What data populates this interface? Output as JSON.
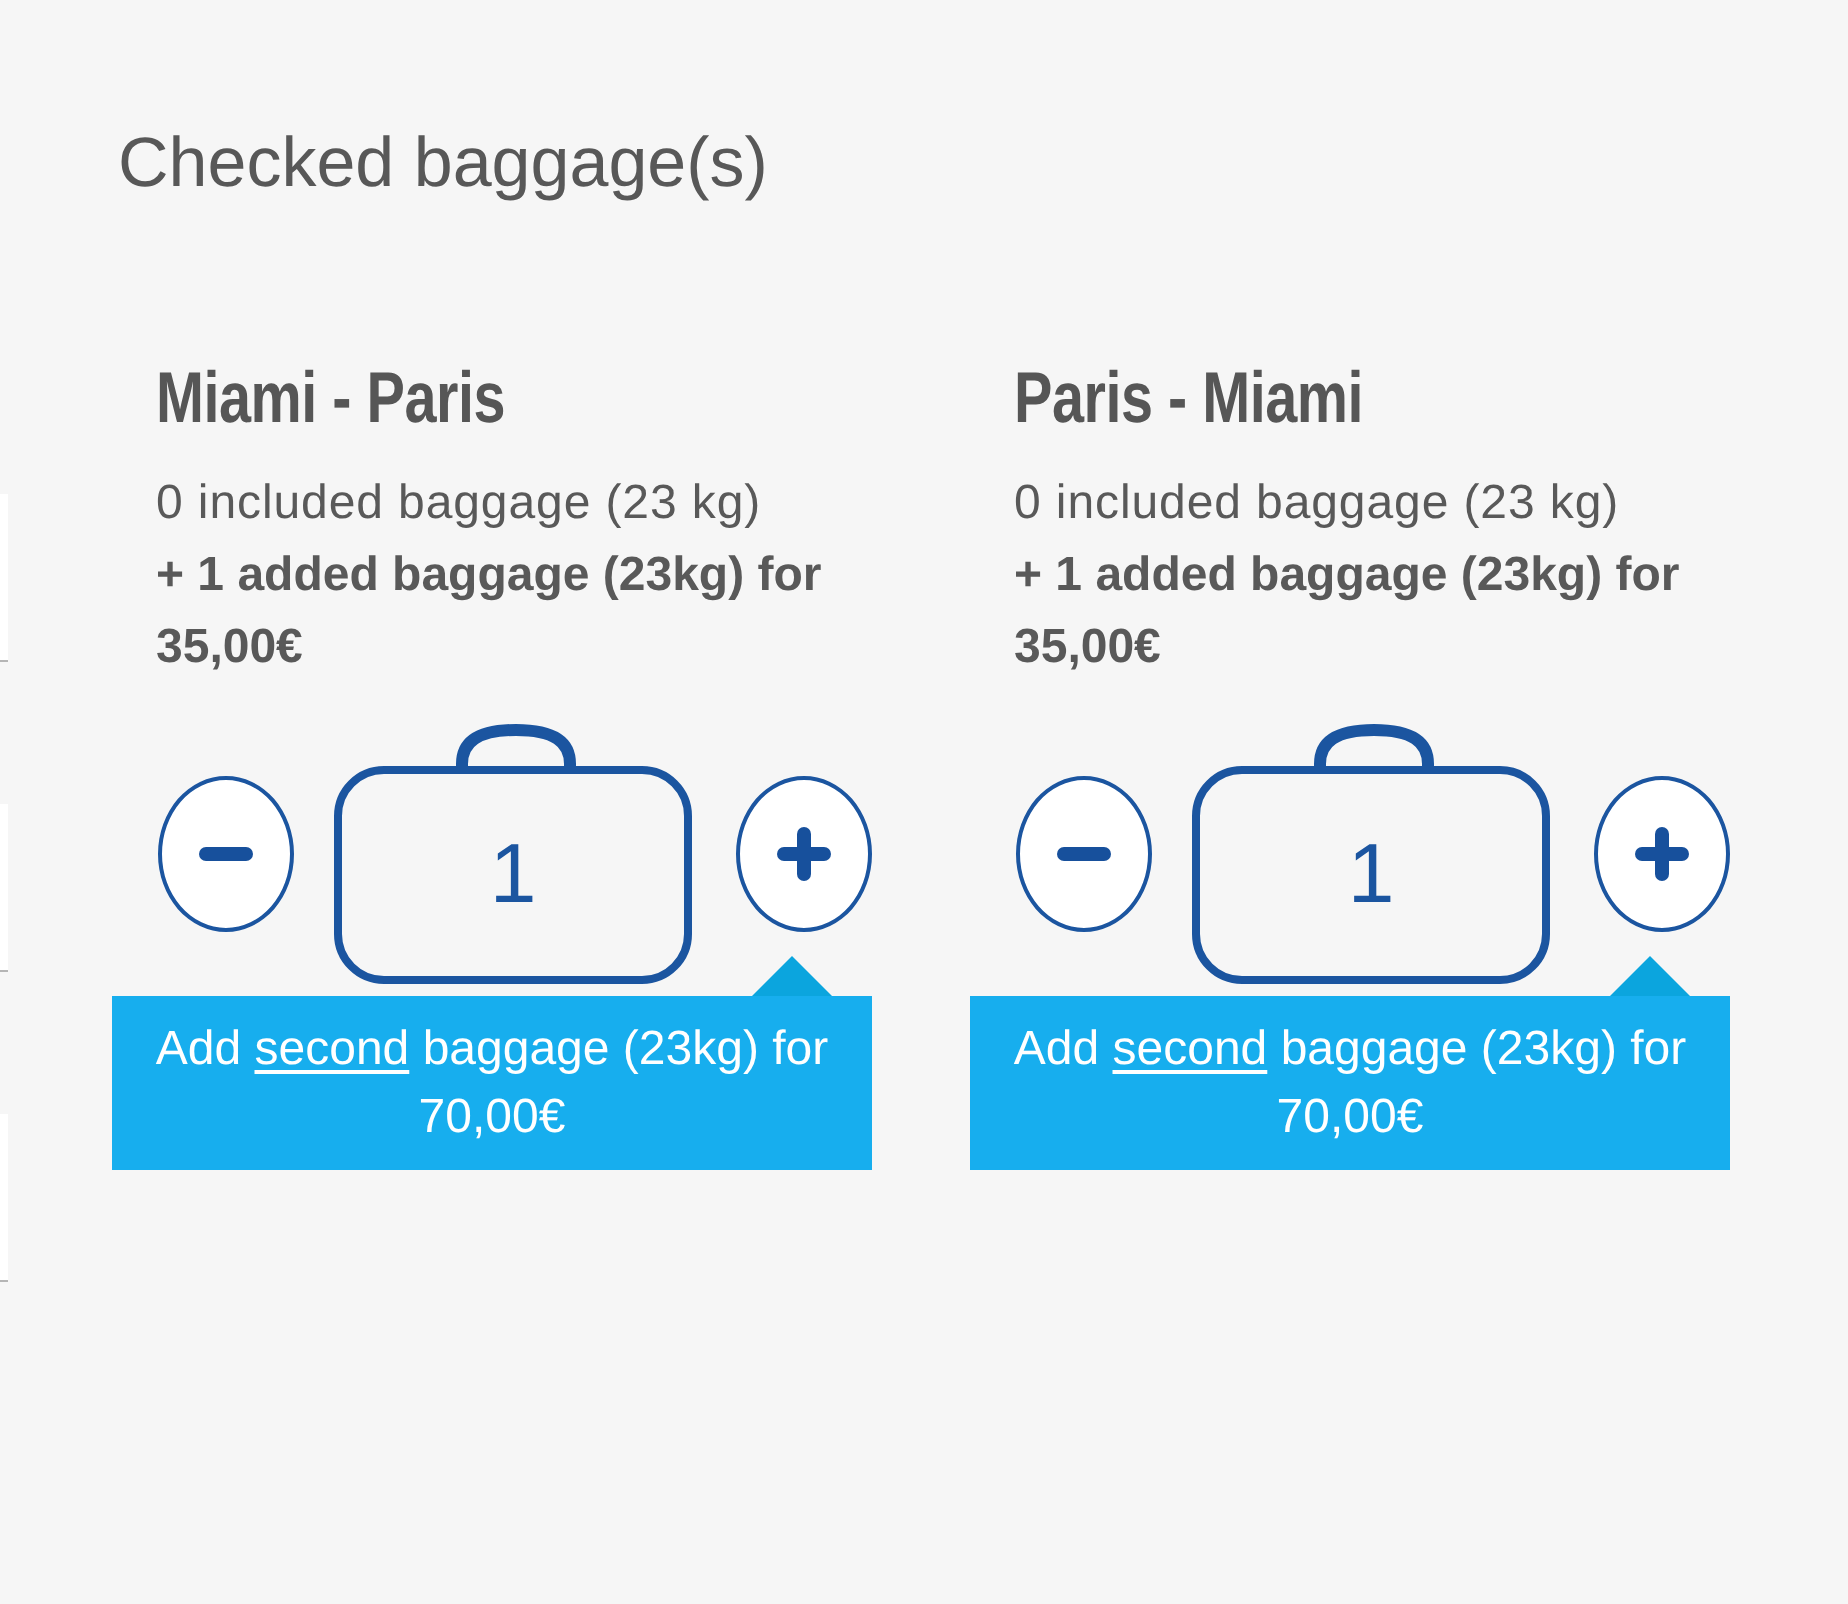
{
  "page": {
    "title": "Checked baggage(s)"
  },
  "flights": [
    {
      "route": "Miami - Paris",
      "included": "0 included baggage (23 kg)",
      "added": "+ 1 added baggage (23kg) for 35,00€",
      "count": "1",
      "tooltip": [
        {
          "text": "Add",
          "underline": false
        },
        {
          "text": "second",
          "underline": true
        },
        {
          "text": "baggage (23kg) for 70,00€",
          "underline": false
        }
      ]
    },
    {
      "route": "Paris - Miami",
      "included": "0 included baggage (23 kg)",
      "added": "+ 1 added baggage (23kg) for 35,00€",
      "count": "1",
      "tooltip": [
        {
          "text": "Add",
          "underline": false
        },
        {
          "text": "second",
          "underline": true
        },
        {
          "text": "baggage (23kg) for 70,00€",
          "underline": false
        }
      ]
    }
  ]
}
